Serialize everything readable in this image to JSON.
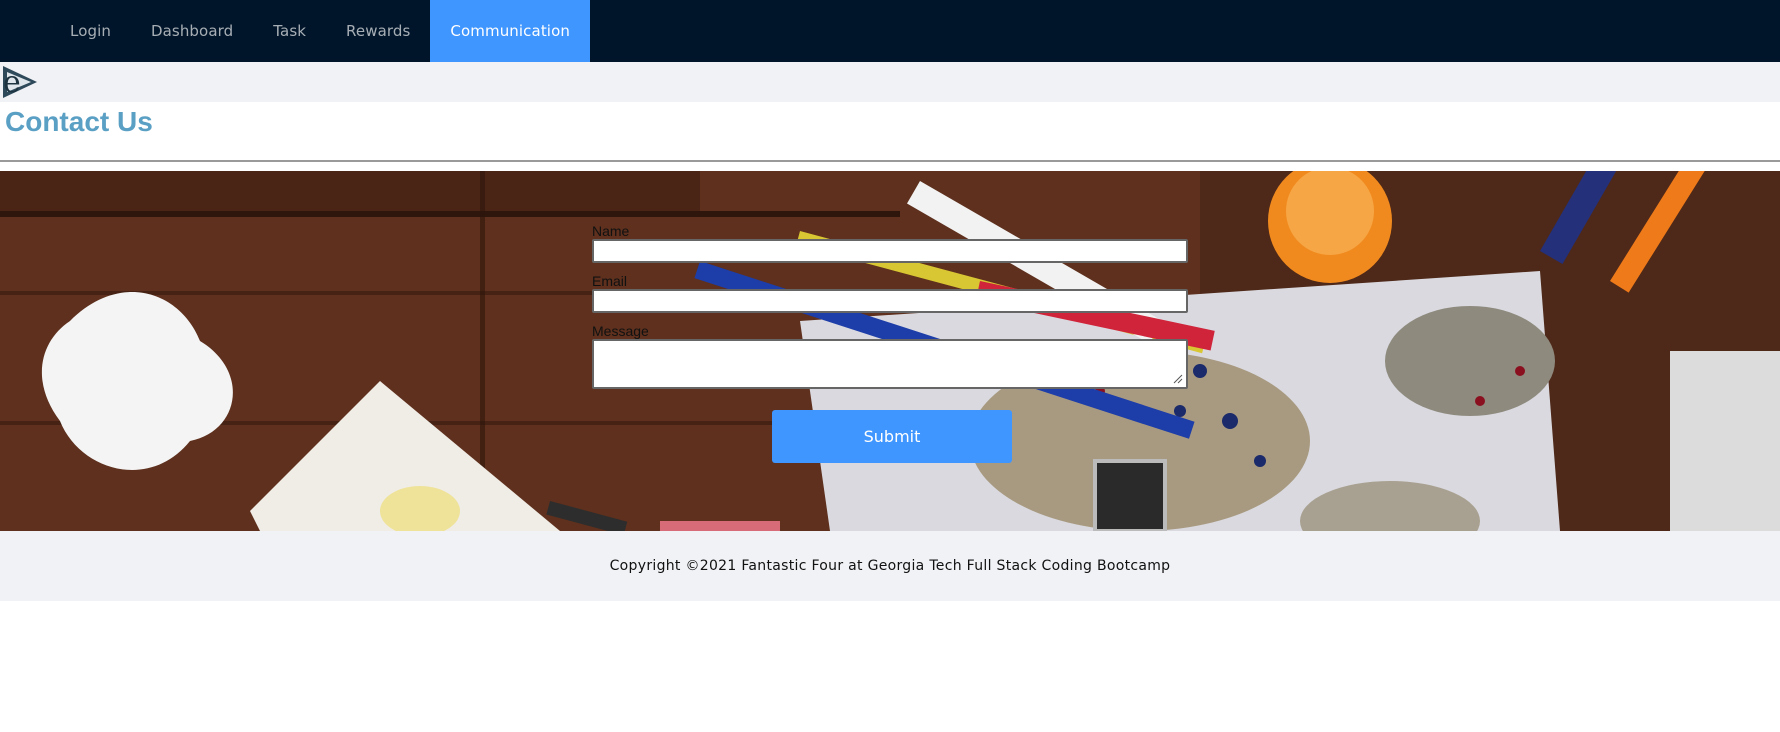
{
  "nav": {
    "items": [
      {
        "label": "Login",
        "active": false
      },
      {
        "label": "Dashboard",
        "active": false
      },
      {
        "label": "Task",
        "active": false
      },
      {
        "label": "Rewards",
        "active": false
      },
      {
        "label": "Communication",
        "active": true
      }
    ],
    "background": "#001529",
    "active_color": "#4096ff"
  },
  "logo": {
    "icon": "e-logo-icon"
  },
  "page": {
    "title": "Contact Us",
    "title_color": "#5a9fc4"
  },
  "form": {
    "name_label": "Name",
    "name_value": "",
    "email_label": "Email",
    "email_value": "",
    "message_label": "Message",
    "message_value": "",
    "submit_label": "Submit"
  },
  "footer": {
    "text": "Copyright ©2021 Fantastic Four at Georgia Tech Full Stack Coding Bootcamp"
  }
}
